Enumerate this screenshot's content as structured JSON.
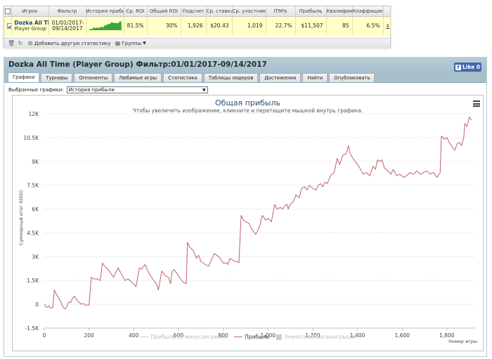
{
  "stats_table": {
    "headers": [
      "",
      "Игрок",
      "Фильтр",
      "История прибыли",
      "Ср. ROI",
      "Общий ROI",
      "Подсчет",
      "Ср. ставка",
      "Ср. участник",
      "ITM%",
      "Прибыль",
      "Квалифик.",
      "Коэффициент",
      ""
    ],
    "row": {
      "player_name": "Dozka All Time",
      "player_sub": "Player Group",
      "filter_line1": "01/01/2017-",
      "filter_line2": "09/14/2017",
      "avg_roi": "81.5%",
      "total_roi": "30%",
      "count": "1,926",
      "avg_stake": "$20.43",
      "avg_entrants": "1,019",
      "itm": "22.7%",
      "profit": "$11,507",
      "qualif": "85",
      "coefficient": "6.5%",
      "remove": "x"
    },
    "toolbar": {
      "add_stats": "Добавить другую статистику",
      "groups": "Группы"
    }
  },
  "panel": {
    "title": "Dozka All Time (Player Group) Фильтр:01/01/2017-09/14/2017",
    "like_label": "Like 0",
    "tabs": [
      "Графики",
      "Турниры",
      "Оппоненты",
      "Любимые игры",
      "Статистика",
      "Таблицы лидеров",
      "Достижения",
      "Найти",
      "Опубликовать"
    ],
    "active_tab": 0,
    "selector_label": "Выбранные графики:",
    "selector_value": "История прибыли"
  },
  "colors": {
    "profit_line": "#c0616b",
    "grid": "#e0e0e0",
    "sparkline": "#3da53d",
    "highlight_row": "#ffffc6",
    "header_bar": "#a8bfcc"
  },
  "chart_data": {
    "type": "line",
    "title": "Общая прибыль",
    "subtitle": "Чтобы увеличить изображение, кликните и перетащите мышкой внутрь графика.",
    "xlabel": "Номер игры",
    "ylabel": "Суммарный итог (USD)",
    "xlim": [
      0,
      1926
    ],
    "ylim": [
      -1500,
      12000
    ],
    "x_ticks": [
      0,
      200,
      400,
      600,
      800,
      1000,
      1200,
      1400,
      1600,
      1800
    ],
    "x_tick_labels": [
      "0",
      "200",
      "400",
      "600",
      "800",
      "1,000",
      "1,200",
      "1,400",
      "1,600",
      "1,800"
    ],
    "y_ticks": [
      -1500,
      0,
      1500,
      3000,
      4500,
      6000,
      7500,
      9000,
      10500,
      12000
    ],
    "y_tick_labels": [
      "-1.5K",
      "0",
      "1.5K",
      "3K",
      "4.5K",
      "6K",
      "7.5K",
      "9K",
      "10.5K",
      "12K"
    ],
    "legend": [
      "Прибыль за минусом рейка",
      "Прибыль",
      "Значительные выигрыши"
    ],
    "series": [
      {
        "name": "Прибыль",
        "points": [
          [
            0,
            0
          ],
          [
            10,
            -200
          ],
          [
            20,
            -100
          ],
          [
            30,
            -250
          ],
          [
            38,
            -200
          ],
          [
            45,
            900
          ],
          [
            55,
            600
          ],
          [
            65,
            400
          ],
          [
            75,
            100
          ],
          [
            85,
            -200
          ],
          [
            95,
            -300
          ],
          [
            110,
            150
          ],
          [
            118,
            100
          ],
          [
            125,
            350
          ],
          [
            135,
            500
          ],
          [
            150,
            200
          ],
          [
            165,
            0
          ],
          [
            175,
            50
          ],
          [
            185,
            -50
          ],
          [
            200,
            -50
          ],
          [
            210,
            1700
          ],
          [
            220,
            1600
          ],
          [
            235,
            1600
          ],
          [
            250,
            1500
          ],
          [
            260,
            2600
          ],
          [
            270,
            2400
          ],
          [
            285,
            2200
          ],
          [
            300,
            1900
          ],
          [
            310,
            1700
          ],
          [
            330,
            2300
          ],
          [
            345,
            1900
          ],
          [
            360,
            1500
          ],
          [
            375,
            1600
          ],
          [
            390,
            1400
          ],
          [
            405,
            1200
          ],
          [
            410,
            1100
          ],
          [
            425,
            2300
          ],
          [
            435,
            2200
          ],
          [
            450,
            2500
          ],
          [
            460,
            2200
          ],
          [
            470,
            1900
          ],
          [
            485,
            1600
          ],
          [
            495,
            1400
          ],
          [
            505,
            1200
          ],
          [
            510,
            900
          ],
          [
            525,
            2100
          ],
          [
            540,
            1800
          ],
          [
            555,
            1700
          ],
          [
            565,
            1300
          ],
          [
            570,
            2000
          ],
          [
            580,
            2200
          ],
          [
            590,
            2000
          ],
          [
            600,
            1800
          ],
          [
            610,
            1600
          ],
          [
            620,
            1400
          ],
          [
            635,
            1300
          ],
          [
            640,
            3900
          ],
          [
            650,
            3600
          ],
          [
            665,
            3400
          ],
          [
            680,
            2900
          ],
          [
            690,
            3100
          ],
          [
            700,
            2700
          ],
          [
            720,
            2500
          ],
          [
            735,
            2400
          ],
          [
            760,
            3200
          ],
          [
            780,
            3000
          ],
          [
            790,
            2800
          ],
          [
            800,
            2600
          ],
          [
            815,
            2600
          ],
          [
            820,
            2500
          ],
          [
            830,
            2900
          ],
          [
            840,
            2800
          ],
          [
            850,
            2700
          ],
          [
            865,
            2700
          ],
          [
            870,
            2600
          ],
          [
            880,
            5600
          ],
          [
            890,
            5300
          ],
          [
            900,
            5200
          ],
          [
            915,
            5100
          ],
          [
            925,
            4800
          ],
          [
            935,
            4600
          ],
          [
            945,
            4400
          ],
          [
            960,
            4800
          ],
          [
            975,
            5600
          ],
          [
            990,
            5300
          ],
          [
            1000,
            5400
          ],
          [
            1015,
            5200
          ],
          [
            1030,
            6300
          ],
          [
            1040,
            6000
          ],
          [
            1055,
            6100
          ],
          [
            1065,
            6000
          ],
          [
            1075,
            6200
          ],
          [
            1085,
            6300
          ],
          [
            1090,
            6000
          ],
          [
            1100,
            6300
          ],
          [
            1115,
            6500
          ],
          [
            1125,
            6900
          ],
          [
            1140,
            6700
          ],
          [
            1150,
            7300
          ],
          [
            1165,
            7400
          ],
          [
            1175,
            7200
          ],
          [
            1185,
            7500
          ],
          [
            1200,
            7300
          ],
          [
            1215,
            7200
          ],
          [
            1225,
            7500
          ],
          [
            1235,
            7600
          ],
          [
            1245,
            7400
          ],
          [
            1255,
            7700
          ],
          [
            1265,
            7600
          ],
          [
            1280,
            8100
          ],
          [
            1295,
            8300
          ],
          [
            1310,
            9200
          ],
          [
            1320,
            8800
          ],
          [
            1335,
            9400
          ],
          [
            1350,
            9500
          ],
          [
            1360,
            10000
          ],
          [
            1365,
            9600
          ],
          [
            1375,
            9300
          ],
          [
            1390,
            9000
          ],
          [
            1410,
            8600
          ],
          [
            1425,
            8200
          ],
          [
            1440,
            8300
          ],
          [
            1455,
            8100
          ],
          [
            1470,
            8700
          ],
          [
            1480,
            8500
          ],
          [
            1490,
            9100
          ],
          [
            1500,
            9000
          ],
          [
            1510,
            9100
          ],
          [
            1520,
            8600
          ],
          [
            1535,
            8400
          ],
          [
            1550,
            8200
          ],
          [
            1560,
            8500
          ],
          [
            1575,
            8100
          ],
          [
            1590,
            8200
          ],
          [
            1605,
            8000
          ],
          [
            1620,
            8100
          ],
          [
            1635,
            8300
          ],
          [
            1650,
            8200
          ],
          [
            1665,
            8400
          ],
          [
            1680,
            8200
          ],
          [
            1695,
            8300
          ],
          [
            1710,
            8400
          ],
          [
            1725,
            8200
          ],
          [
            1740,
            8300
          ],
          [
            1755,
            8000
          ],
          [
            1770,
            8300
          ],
          [
            1775,
            10600
          ],
          [
            1790,
            10400
          ],
          [
            1800,
            10500
          ],
          [
            1810,
            10200
          ],
          [
            1820,
            10000
          ],
          [
            1835,
            9700
          ],
          [
            1845,
            10100
          ],
          [
            1855,
            10200
          ],
          [
            1865,
            10000
          ],
          [
            1875,
            10500
          ],
          [
            1880,
            11400
          ],
          [
            1890,
            11200
          ],
          [
            1900,
            11800
          ],
          [
            1910,
            11600
          ]
        ]
      }
    ]
  }
}
